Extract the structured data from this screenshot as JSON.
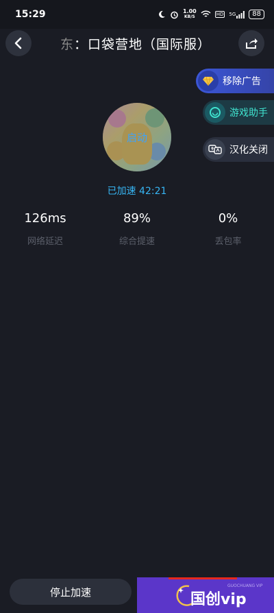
{
  "status_bar": {
    "time": "15:29",
    "net_speed_value": "1.00",
    "net_speed_unit": "KB/S",
    "hd_label": "HD",
    "signal_label": "5G",
    "battery": "88"
  },
  "nav": {
    "title_cut_char": "东",
    "title": "：口袋营地（国际服）"
  },
  "side_actions": {
    "remove_ads": "移除广告",
    "game_assistant": "游戏助手",
    "cn_off": "汉化关闭"
  },
  "game": {
    "launch_label": "启动",
    "accelerated_text": "已加速 42:21"
  },
  "stats": [
    {
      "value": "126ms",
      "label": "网络延迟"
    },
    {
      "value": "89%",
      "label": "综合提速"
    },
    {
      "value": "0%",
      "label": "丢包率"
    }
  ],
  "bottom": {
    "stop_label": "停止加速",
    "vip_label": "国创vip",
    "vip_sub": "GUOCHUANG VIP"
  },
  "colors": {
    "accent_blue": "#37b6f5",
    "teal": "#40e4d0",
    "vip_purple": "#5b36c9"
  }
}
